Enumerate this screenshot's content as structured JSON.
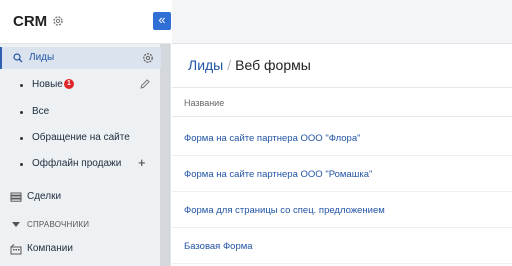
{
  "sidebar": {
    "app_title": "CRM",
    "collapse_glyph": "«",
    "items": [
      {
        "label": "Лиды",
        "icon": "search-icon"
      },
      {
        "label": "Новые",
        "badge": "1"
      },
      {
        "label": "Все"
      },
      {
        "label": "Обращение на сайте"
      },
      {
        "label": "Оффлайн продажи",
        "action": "+"
      },
      {
        "label": "Сделки",
        "icon": "stack-icon"
      },
      {
        "label": "Компании",
        "icon": "building-icon"
      }
    ],
    "section_label": "СПРАВОЧНИКИ"
  },
  "breadcrumb": {
    "parent": "Лиды",
    "separator": "/",
    "current": "Веб формы"
  },
  "table": {
    "column_header": "Название",
    "rows": [
      "Форма на сайте партнера ООО \"Флора\"",
      "Форма на сайте партнера ООО \"Ромашка\"",
      "Форма для страницы со спец. предложением",
      "Базовая Форма"
    ]
  },
  "colors": {
    "accent": "#2255a4",
    "badge": "#e0262b",
    "sidebar_bg": "#eef1f4"
  }
}
